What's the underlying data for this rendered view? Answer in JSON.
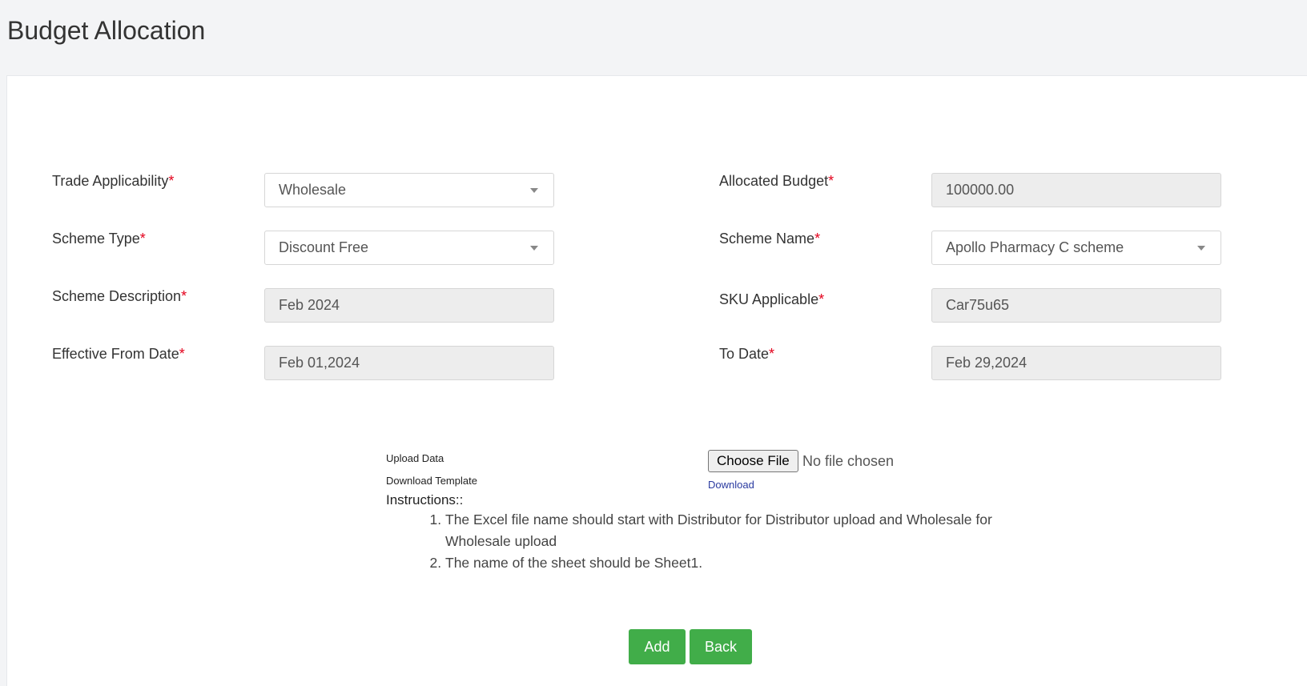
{
  "page": {
    "title": "Budget Allocation"
  },
  "form": {
    "trade_applicability": {
      "label": "Trade Applicability",
      "value": "Wholesale"
    },
    "allocated_budget": {
      "label": "Allocated Budget",
      "value": "100000.00"
    },
    "scheme_type": {
      "label": "Scheme Type",
      "value": "Discount Free"
    },
    "scheme_name": {
      "label": "Scheme Name",
      "value": "Apollo Pharmacy C scheme"
    },
    "scheme_description": {
      "label": "Scheme Description",
      "value": "Feb 2024"
    },
    "sku_applicable": {
      "label": "SKU Applicable",
      "value": "Car75u65"
    },
    "effective_from_date": {
      "label": "Effective From Date",
      "value": "Feb 01,2024"
    },
    "to_date": {
      "label": "To Date",
      "value": "Feb 29,2024"
    },
    "required_marker": "*"
  },
  "upload": {
    "upload_label": "Upload Data",
    "choose_file_label": "Choose File",
    "file_status": "No file chosen",
    "template_label": "Download Template",
    "download_link": "Download"
  },
  "instructions": {
    "title": "Instructions::",
    "items": [
      "The Excel file name should start with Distributor for Distributor upload and Wholesale for Wholesale upload",
      "The name of the sheet should be Sheet1."
    ]
  },
  "actions": {
    "add_label": "Add",
    "back_label": "Back",
    "accent": "#41ad49"
  }
}
